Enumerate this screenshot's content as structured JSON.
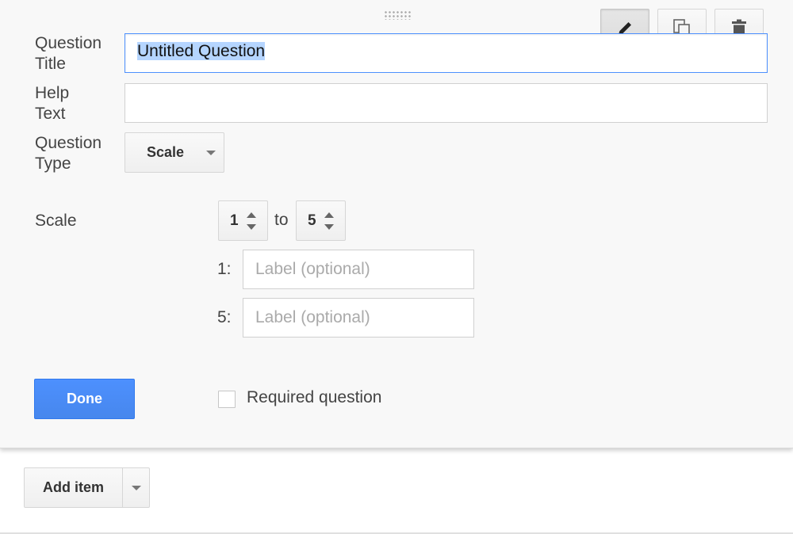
{
  "editor": {
    "question_title_label": "Question\nTitle",
    "question_title_value": "Untitled Question",
    "help_text_label": "Help\nText",
    "help_text_value": "",
    "question_type_label": "Question\nType",
    "question_type_value": "Scale",
    "scale_label": "Scale",
    "scale_from": "1",
    "scale_to_word": "to",
    "scale_to": "5",
    "low_label_prefix": "1:",
    "high_label_prefix": "5:",
    "label_placeholder": "Label (optional)",
    "done_label": "Done",
    "required_label": "Required question",
    "required_checked": false
  },
  "toolbar": {
    "icons": [
      "pencil-icon",
      "duplicate-icon",
      "trash-icon"
    ]
  },
  "footer": {
    "add_item_label": "Add item"
  },
  "colors": {
    "accent": "#4d90fe",
    "selection": "#b5d5ff",
    "panel_bg": "#f8f8f8"
  }
}
